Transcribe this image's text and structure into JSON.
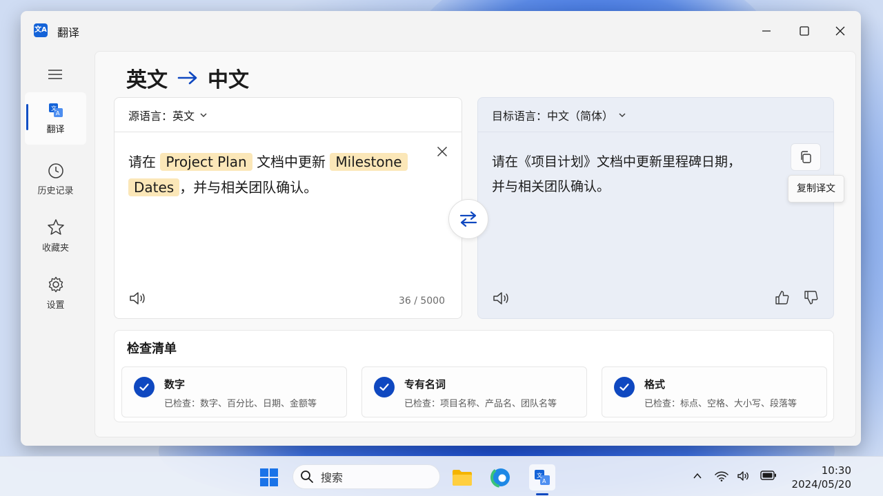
{
  "window": {
    "title": "翻译"
  },
  "sidebar": {
    "items": [
      {
        "label": "翻译",
        "icon": "translate-icon",
        "active": true
      },
      {
        "label": "历史记录",
        "icon": "history-icon"
      },
      {
        "label": "收藏夹",
        "icon": "star-icon"
      },
      {
        "label": "设置",
        "icon": "gear-icon"
      }
    ]
  },
  "main": {
    "heading_from": "英文",
    "heading_to": "中文"
  },
  "source": {
    "lang_label": "源语言：英文",
    "text": {
      "p1": "请在",
      "t1": "Project Plan",
      "p2": "文档中更新",
      "t2": "Milestone",
      "t3": "Dates",
      "p3": "，并与相关团队确认。"
    },
    "counter": "36 / 5000"
  },
  "target": {
    "lang_label": "目标语言：中文（简体）",
    "line1": "请在《项目计划》文档中更新里程碑日期，",
    "line2": "并与相关团队确认。",
    "copy_tooltip": "复制译文"
  },
  "checklist": {
    "title": "检查清单",
    "items": [
      {
        "name": "数字",
        "desc": "已检查：数字、百分比、日期、金额等"
      },
      {
        "name": "专有名词",
        "desc": "已检查：项目名称、产品名、团队名等"
      },
      {
        "name": "格式",
        "desc": "已检查：标点、空格、大小写、段落等"
      }
    ]
  },
  "taskbar": {
    "search_placeholder": "搜索",
    "time": "10:30",
    "date": "2024/05/20"
  },
  "colors": {
    "accent": "#0f48c0",
    "highlight": "#fbe7b8",
    "target_bg": "#eaeef6"
  }
}
